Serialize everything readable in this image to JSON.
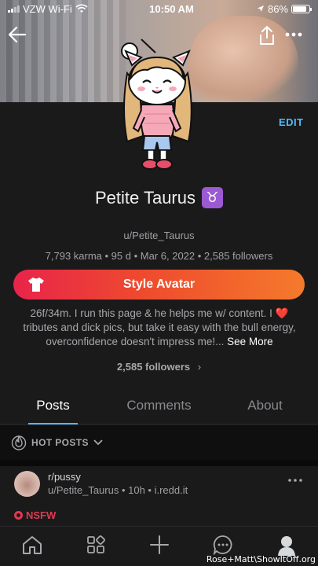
{
  "status": {
    "carrier": "VZW Wi-Fi",
    "time": "10:50 AM",
    "battery": "86%",
    "battery_level": 0.86
  },
  "header": {
    "edit_label": "EDIT"
  },
  "profile": {
    "display_name": "Petite Taurus",
    "zodiac_symbol": "♉",
    "username": "u/Petite_Taurus",
    "stats": "7,793 karma • 95 d • Mar 6, 2022 • 2,585 followers",
    "style_button_label": "Style Avatar",
    "bio_text": "26f/34m. I run this page & he helps me w/ content. I ",
    "bio_heart": "❤️",
    "bio_text2": " tributes and dick pics, but take it easy with the bull energy, overconfidence doesn't impress me!...",
    "see_more": " See More",
    "followers_link": "2,585 followers",
    "followers_chevron": "›"
  },
  "tabs": [
    {
      "label": "Posts"
    },
    {
      "label": "Comments"
    },
    {
      "label": "About"
    }
  ],
  "feed": {
    "sort_label": "HOT POSTS",
    "post": {
      "subreddit": "r/pussy",
      "meta": "u/Petite_Taurus • 10h • i.redd.it",
      "tag": "NSFW"
    }
  },
  "watermark": "Rose+Matt\\ShowItOff.org",
  "colors": {
    "accent": "#4fbcff",
    "button_start": "#e8244a",
    "button_end": "#f57a2b",
    "nsfw": "#e0394f",
    "zodiac_bg": "#9b59d4"
  },
  "icons": [
    "back-arrow-icon",
    "share-icon",
    "more-icon",
    "wifi-icon",
    "location-icon",
    "shirt-icon",
    "flame-icon",
    "chevron-down-icon",
    "home-icon",
    "grid-icon",
    "plus-icon",
    "chat-icon",
    "avatar-icon"
  ]
}
